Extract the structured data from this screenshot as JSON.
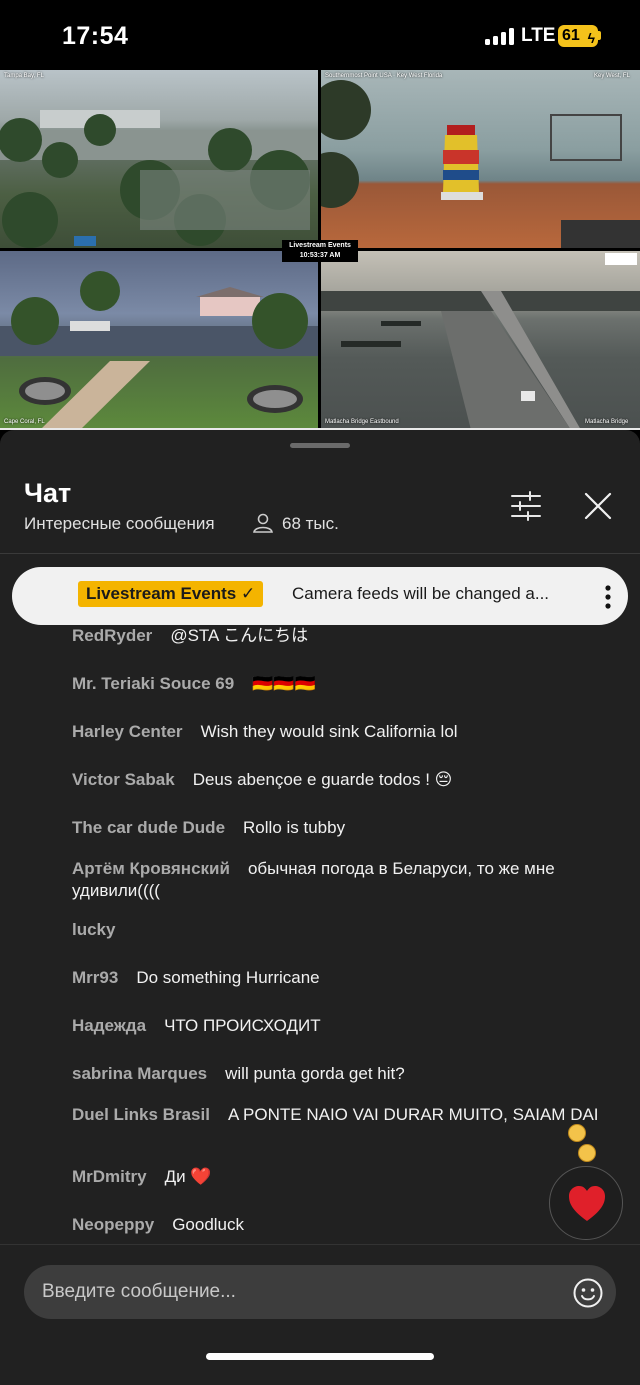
{
  "status_bar": {
    "time": "17:54",
    "network": "LTE",
    "battery": "61"
  },
  "video": {
    "badge_line1": "Livestream Events",
    "badge_line2": "10:53:37 AM",
    "cams": [
      {
        "label": "Tampa Bay, FL"
      },
      {
        "label": "Key West, FL"
      },
      {
        "label": "Cape Coral, FL"
      },
      {
        "label": "Matlacha Bridge"
      }
    ]
  },
  "chat": {
    "title": "Чат",
    "subtitle": "Интересные сообщения",
    "viewers": "68 тыс.",
    "pinned": {
      "tag": "Livestream Events ✓",
      "text": "Camera feeds will be changed a..."
    },
    "messages": [
      {
        "author": "RedRyder",
        "text": "@STA こんにちは"
      },
      {
        "author": "Mr. Teriaki Souce 69",
        "text": "🇩🇪🇩🇪🇩🇪"
      },
      {
        "author": "Harley Center",
        "text": "Wish they would sink California lol"
      },
      {
        "author": "Victor Sabak",
        "text": "Deus abençoe e guarde todos ! 😔"
      },
      {
        "author": "The car dude Dude",
        "text": "Rollo is tubby"
      },
      {
        "author": "Артём Кровянский",
        "text": "обычная погода в Беларуси, то же мне удивили(((("
      },
      {
        "author": "lucky",
        "text": ""
      },
      {
        "author": "Mrr93",
        "text": "Do something Hurricane"
      },
      {
        "author": "Надежда",
        "text": "ЧТО ПРОИСХОДИТ"
      },
      {
        "author": "sabrina Marques",
        "text": "will punta gorda get hit?"
      },
      {
        "author": "Duel Links Brasil",
        "text": "A PONTE NAIO VAI DURAR MUITO, SAIAM DAI"
      },
      {
        "author": "MrDmitry",
        "text": "Ди ❤️"
      },
      {
        "author": "Neopeppy",
        "text": "Goodluck"
      }
    ],
    "input_placeholder": "Введите сообщение..."
  },
  "colors": {
    "panel": "#212121",
    "pinned_tag": "#f4b400",
    "heart": "#e0202a"
  }
}
